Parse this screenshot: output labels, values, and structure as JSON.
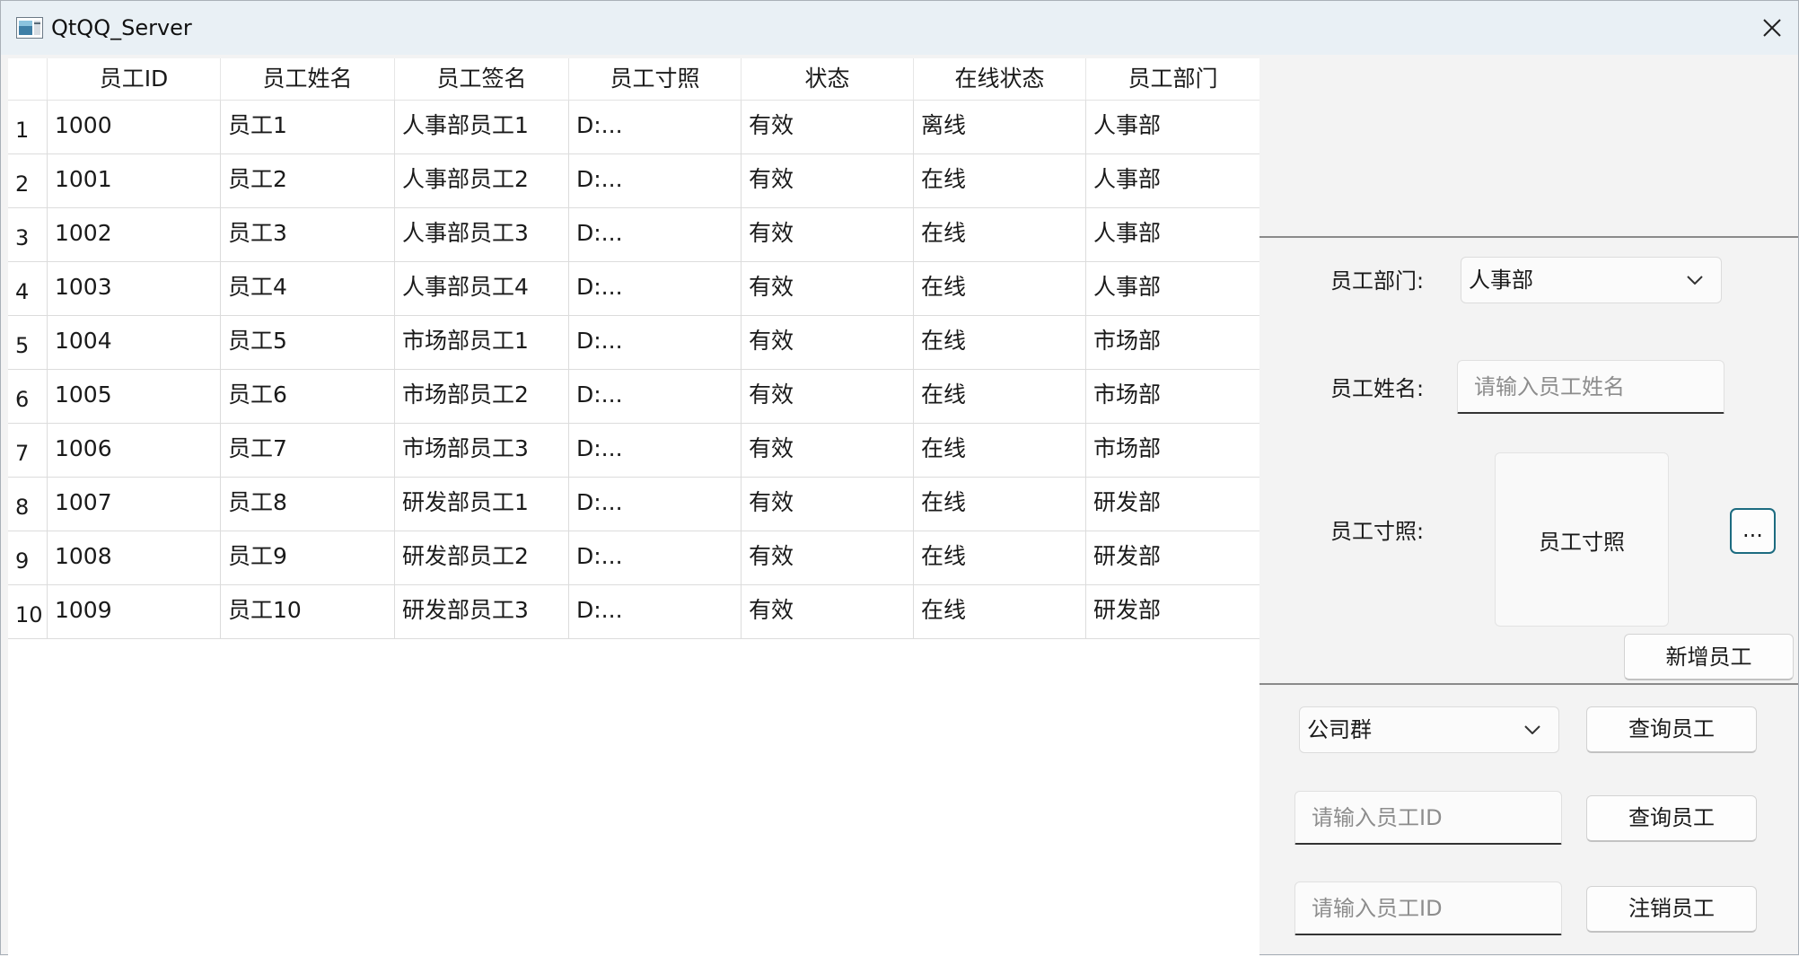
{
  "window": {
    "title": "QtQQ_Server",
    "close_symbol": "✕"
  },
  "table": {
    "columns": [
      "员工ID",
      "员工姓名",
      "员工签名",
      "员工寸照",
      "状态",
      "在线状态",
      "员工部门"
    ],
    "rows": [
      {
        "num": "1",
        "cells": [
          "1000",
          "员工1",
          "人事部员工1",
          "D:...",
          "有效",
          "离线",
          "人事部"
        ]
      },
      {
        "num": "2",
        "cells": [
          "1001",
          "员工2",
          "人事部员工2",
          "D:...",
          "有效",
          "在线",
          "人事部"
        ]
      },
      {
        "num": "3",
        "cells": [
          "1002",
          "员工3",
          "人事部员工3",
          "D:...",
          "有效",
          "在线",
          "人事部"
        ]
      },
      {
        "num": "4",
        "cells": [
          "1003",
          "员工4",
          "人事部员工4",
          "D:...",
          "有效",
          "在线",
          "人事部"
        ]
      },
      {
        "num": "5",
        "cells": [
          "1004",
          "员工5",
          "市场部员工1",
          "D:...",
          "有效",
          "在线",
          "市场部"
        ]
      },
      {
        "num": "6",
        "cells": [
          "1005",
          "员工6",
          "市场部员工2",
          "D:...",
          "有效",
          "在线",
          "市场部"
        ]
      },
      {
        "num": "7",
        "cells": [
          "1006",
          "员工7",
          "市场部员工3",
          "D:...",
          "有效",
          "在线",
          "市场部"
        ]
      },
      {
        "num": "8",
        "cells": [
          "1007",
          "员工8",
          "研发部员工1",
          "D:...",
          "有效",
          "在线",
          "研发部"
        ]
      },
      {
        "num": "9",
        "cells": [
          "1008",
          "员工9",
          "研发部员工2",
          "D:...",
          "有效",
          "在线",
          "研发部"
        ]
      },
      {
        "num": "10",
        "cells": [
          "1009",
          "员工10",
          "研发部员工3",
          "D:...",
          "有效",
          "在线",
          "研发部"
        ]
      }
    ]
  },
  "form": {
    "dept_label": "员工部门:",
    "dept_value": "人事部",
    "name_label": "员工姓名:",
    "name_placeholder": "请输入员工姓名",
    "photo_label": "员工寸照:",
    "photo_text": "员工寸照",
    "browse_label": "...",
    "add_button": "新增员工"
  },
  "query": {
    "group_value": "公司群",
    "query_button_1": "查询员工",
    "id_placeholder_1": "请输入员工ID",
    "query_button_2": "查询员工",
    "id_placeholder_2": "请输入员工ID",
    "logout_button": "注销员工"
  },
  "colors": {
    "titlebar": "#e9f0f5",
    "accent": "#1c6b80",
    "background": "#f3f3f3"
  },
  "icons": {
    "app": "app-window-icon",
    "close": "close-icon",
    "chevron": "chevron-down-icon"
  }
}
